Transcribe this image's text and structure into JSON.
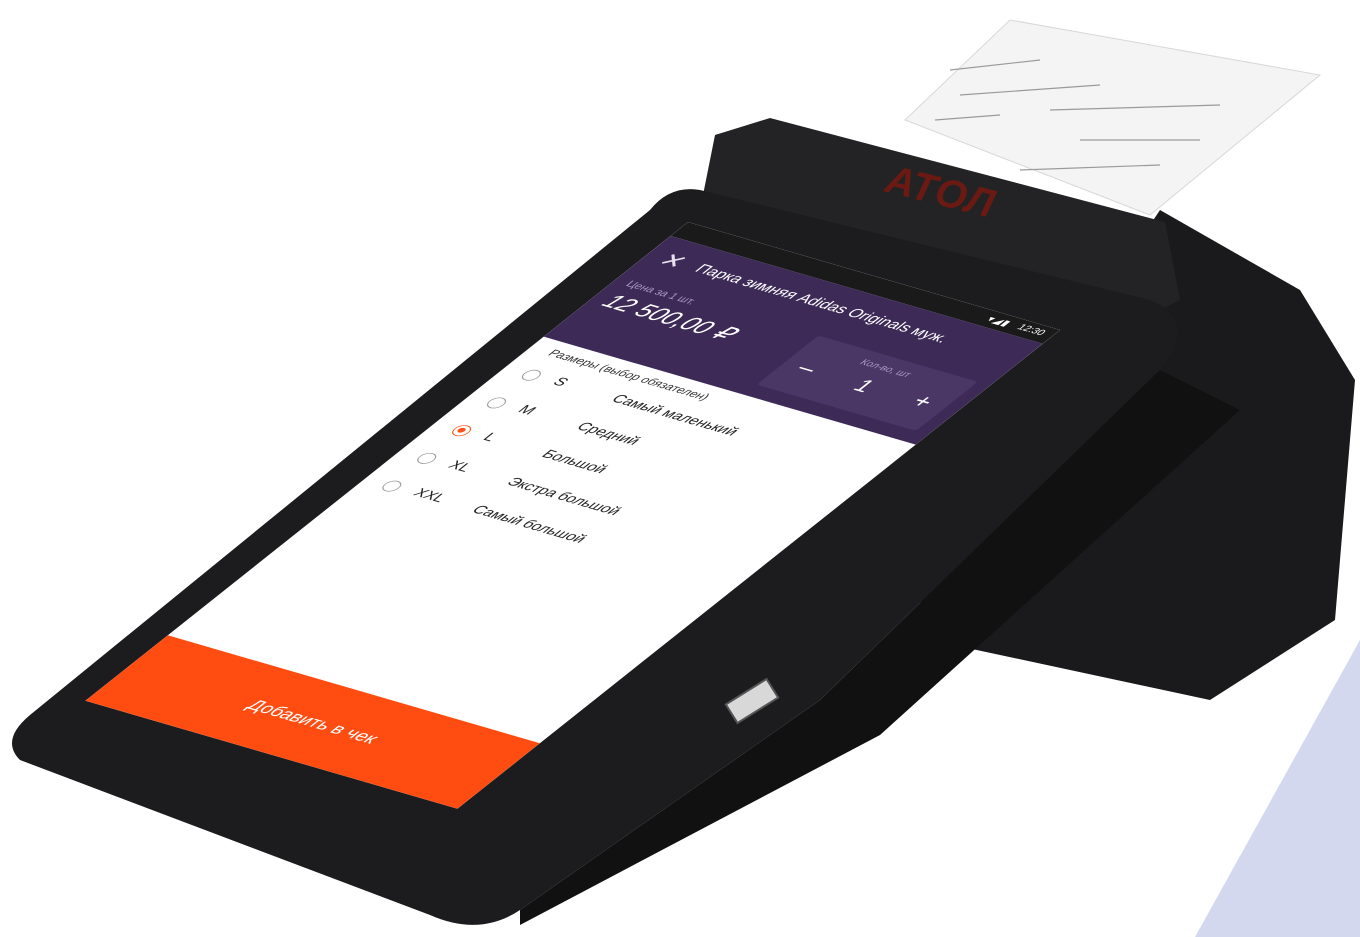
{
  "device": {
    "brand_logo": "АТОЛ",
    "status_bar": {
      "time": "12:30",
      "icons": [
        "wifi-icon",
        "signal-icon",
        "battery-icon"
      ]
    }
  },
  "header": {
    "close_icon": "close-icon",
    "product_title": "Парка зимняя Adidas Originals муж.",
    "price_caption": "Цена за 1 шт.",
    "price_value": "12 500,00 ₽",
    "quantity_caption": "Кол-во, шт",
    "quantity_value": "1",
    "minus_label": "–",
    "plus_label": "+"
  },
  "options": {
    "title": "Размеры (выбор обязателен)",
    "items": [
      {
        "code": "S",
        "label": "Самый маленький",
        "checked": false
      },
      {
        "code": "M",
        "label": "Средний",
        "checked": false
      },
      {
        "code": "L",
        "label": "Большой",
        "checked": true
      },
      {
        "code": "XL",
        "label": "Экстра большой",
        "checked": false
      },
      {
        "code": "XXL",
        "label": "Самый большой",
        "checked": false
      }
    ]
  },
  "actions": {
    "add_to_receipt": "Добавить в чек"
  },
  "colors": {
    "header_bg": "#3d2a57",
    "accent": "#ff4d12",
    "device_body": "#1c1c1e",
    "background_triangle": "#d3d8ee"
  }
}
